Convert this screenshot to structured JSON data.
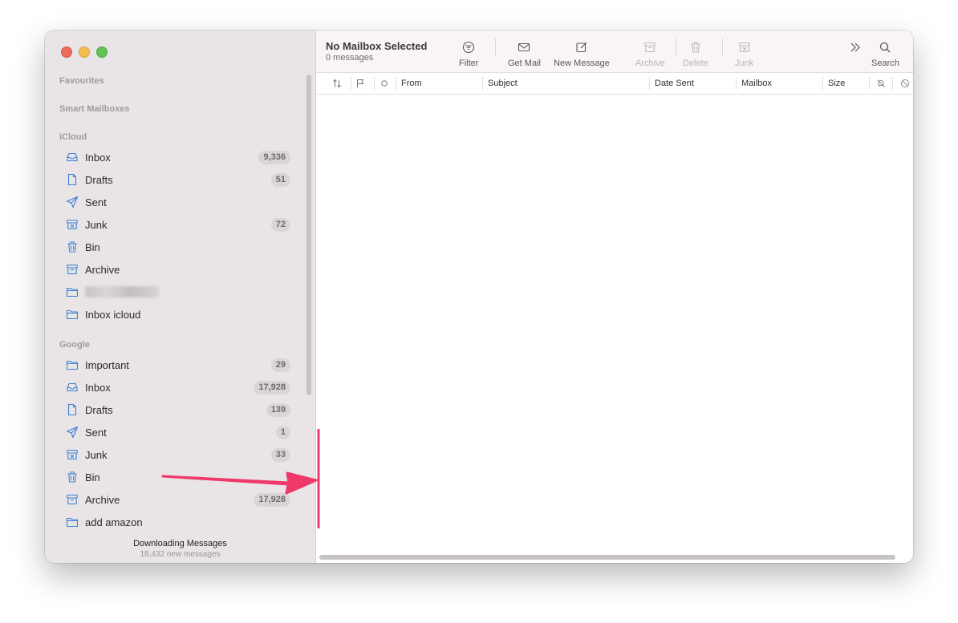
{
  "colors": {
    "sidebar_bg": "#e9e4e5",
    "icon_blue": "#3b82d6",
    "arrow_pink": "#f0386b",
    "toolbar_bg": "#faf4f5"
  },
  "sidebar": {
    "sections": {
      "favourites": "Favourites",
      "smart_mailboxes": "Smart Mailboxes",
      "icloud": "iCloud",
      "google": "Google"
    },
    "icloud_items": [
      {
        "label": "Inbox",
        "count": "9,336",
        "icon": "inbox-icon"
      },
      {
        "label": "Drafts",
        "count": "51",
        "icon": "drafts-icon"
      },
      {
        "label": "Sent",
        "count": "",
        "icon": "sent-icon"
      },
      {
        "label": "Junk",
        "count": "72",
        "icon": "junk-icon"
      },
      {
        "label": "Bin",
        "count": "",
        "icon": "bin-icon"
      },
      {
        "label": "Archive",
        "count": "",
        "icon": "archive-icon"
      },
      {
        "label": "",
        "count": "",
        "icon": "folder-icon"
      },
      {
        "label": "Inbox icloud",
        "count": "",
        "icon": "folder-icon"
      }
    ],
    "google_items": [
      {
        "label": "Important",
        "count": "29",
        "icon": "folder-icon"
      },
      {
        "label": "Inbox",
        "count": "17,928",
        "icon": "inbox-icon"
      },
      {
        "label": "Drafts",
        "count": "139",
        "icon": "drafts-icon"
      },
      {
        "label": "Sent",
        "count": "1",
        "icon": "sent-icon"
      },
      {
        "label": "Junk",
        "count": "33",
        "icon": "junk-icon"
      },
      {
        "label": "Bin",
        "count": "",
        "icon": "bin-icon"
      },
      {
        "label": "Archive",
        "count": "17,928",
        "icon": "archive-icon"
      },
      {
        "label": "add amazon",
        "count": "",
        "icon": "folder-icon"
      }
    ],
    "status": {
      "title": "Downloading Messages",
      "subtitle": "18,432 new messages"
    }
  },
  "toolbar": {
    "title": "No Mailbox Selected",
    "subtitle": "0 messages",
    "filter": "Filter",
    "get_mail": "Get Mail",
    "new_message": "New Message",
    "archive": "Archive",
    "delete": "Delete",
    "junk": "Junk",
    "search": "Search"
  },
  "columns": {
    "from": "From",
    "subject": "Subject",
    "date_sent": "Date Sent",
    "mailbox": "Mailbox",
    "size": "Size"
  }
}
